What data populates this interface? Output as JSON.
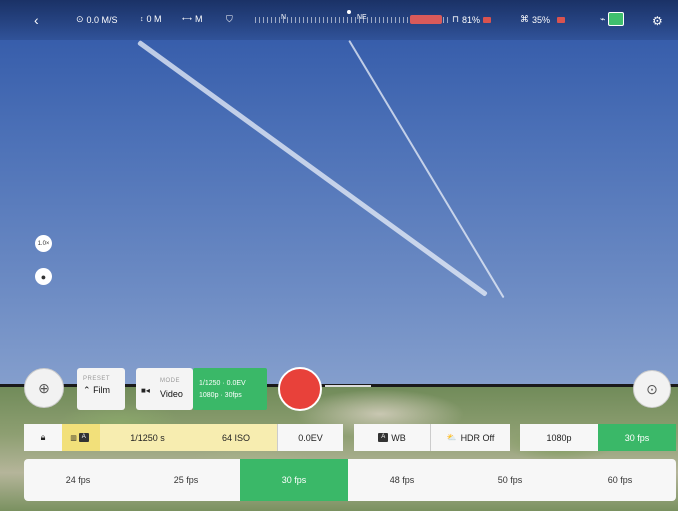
{
  "topbar": {
    "back_icon": "chevron-left-icon",
    "speed": "0.0 M/S",
    "altitude": "0 M",
    "distance": "M",
    "compass_n": "N",
    "compass_ne": "NE",
    "controller_battery": "81%",
    "drone_battery": "35%",
    "settings_icon": "gear-icon"
  },
  "left": {
    "zoom_label": "1.0×"
  },
  "controls": {
    "preset_small": "PRESET",
    "preset_value": "Film",
    "mode_small": "MODE",
    "mode_value": "Video",
    "summary_line1": "1/1250 · 0.0EV",
    "summary_line2": "1080p · 30fps"
  },
  "settings_row": {
    "lock_icon": "lock-icon",
    "auto_badge": "A",
    "shutter": "1/1250 s",
    "iso": "64 ISO",
    "ev": "0.0EV",
    "wb_badge": "A",
    "wb": "WB",
    "hdr": "HDR Off",
    "resolution": "1080p",
    "fps": "30 fps"
  },
  "fps_options": [
    "24 fps",
    "25 fps",
    "30 fps",
    "48 fps",
    "50 fps",
    "60 fps"
  ],
  "colors": {
    "accent_green": "#3ab868",
    "record_red": "#e8413a",
    "highlight_yellow": "#f7edb0"
  }
}
